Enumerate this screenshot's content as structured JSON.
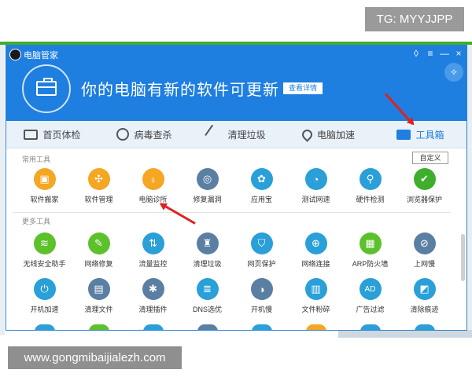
{
  "watermark": {
    "top": "TG: MYYJJPP",
    "bottom": "www.gongmibaijialezh.com"
  },
  "window": {
    "title": "电脑管家",
    "controls": [
      "◊",
      "≡",
      "—",
      "×"
    ],
    "headline": "你的电脑有新的软件可更新",
    "detail_button": "查看详情",
    "pin": "✧"
  },
  "nav": {
    "tabs": [
      {
        "label": "首页体检",
        "icon": "monitor-icon"
      },
      {
        "label": "病毒查杀",
        "icon": "virus-icon"
      },
      {
        "label": "清理垃圾",
        "icon": "broom-icon"
      },
      {
        "label": "电脑加速",
        "icon": "rocket-icon"
      },
      {
        "label": "工具箱",
        "icon": "toolbox-icon",
        "active": true
      }
    ]
  },
  "common_tools": {
    "label": "常用工具",
    "customize": "自定义",
    "items": [
      {
        "label": "软件搬家",
        "icon": "truck-icon",
        "color": "#f5a623",
        "glyph": "▣"
      },
      {
        "label": "软件管理",
        "icon": "clover-icon",
        "color": "#f5a623",
        "glyph": "✣"
      },
      {
        "label": "电脑诊所",
        "icon": "stethoscope-icon",
        "color": "#f5a623",
        "glyph": "♁"
      },
      {
        "label": "修复漏洞",
        "icon": "globe-repair-icon",
        "color": "#5b7fa3",
        "glyph": "◎"
      },
      {
        "label": "应用宝",
        "icon": "app-store-icon",
        "color": "#2a9fd8",
        "glyph": "✿"
      },
      {
        "label": "测试网速",
        "icon": "speedometer-icon",
        "color": "#2a9fd8",
        "glyph": "◔"
      },
      {
        "label": "硬件检测",
        "icon": "chip-search-icon",
        "color": "#2a9fd8",
        "glyph": "⚲"
      },
      {
        "label": "浏览器保护",
        "icon": "browser-shield-icon",
        "color": "#3fae2c",
        "glyph": "✔"
      }
    ]
  },
  "more_tools": {
    "label": "更多工具",
    "items": [
      {
        "label": "无线安全助手",
        "icon": "wifi-icon",
        "color": "#5cc12a",
        "glyph": "≋"
      },
      {
        "label": "网络修复",
        "icon": "wrench-icon",
        "color": "#5cc12a",
        "glyph": "✎"
      },
      {
        "label": "流量监控",
        "icon": "traffic-arrows-icon",
        "color": "#2a9fd8",
        "glyph": "⇅"
      },
      {
        "label": "清理垃圾",
        "icon": "trash-icon",
        "color": "#5b7fa3",
        "glyph": "♜"
      },
      {
        "label": "网页保护",
        "icon": "shield-icon",
        "color": "#2a9fd8",
        "glyph": "⛉"
      },
      {
        "label": "网络连接",
        "icon": "network-globe-icon",
        "color": "#2a9fd8",
        "glyph": "⊕"
      },
      {
        "label": "ARP防火墙",
        "icon": "firewall-icon",
        "color": "#5cc12a",
        "glyph": "▦"
      },
      {
        "label": "上网慢",
        "icon": "slow-net-icon",
        "color": "#5b7fa3",
        "glyph": "⊘"
      },
      {
        "label": "开机加速",
        "icon": "power-icon",
        "color": "#2a9fd8",
        "glyph": "⏻"
      },
      {
        "label": "清理文件",
        "icon": "file-clean-icon",
        "color": "#5b7fa3",
        "glyph": "▤"
      },
      {
        "label": "清理插件",
        "icon": "plugin-icon",
        "color": "#5b7fa3",
        "glyph": "✱"
      },
      {
        "label": "DNS选优",
        "icon": "dns-icon",
        "color": "#2a9fd8",
        "glyph": "≣"
      },
      {
        "label": "开机慢",
        "icon": "boot-slow-icon",
        "color": "#5b7fa3",
        "glyph": "◑"
      },
      {
        "label": "文件粉碎",
        "icon": "shredder-icon",
        "color": "#2a9fd8",
        "glyph": "▥"
      },
      {
        "label": "广告过滤",
        "icon": "ad-filter-icon",
        "color": "#2a9fd8",
        "glyph": "AD"
      },
      {
        "label": "清除痕迹",
        "icon": "eraser-icon",
        "color": "#2a9fd8",
        "glyph": "◩"
      }
    ]
  },
  "partial_row_colors": [
    "#2a9fd8",
    "#5cc12a",
    "#2a9fd8",
    "#5b7fa3",
    "#2a9fd8",
    "#f5a623",
    "#2a9fd8",
    "#2a9fd8"
  ]
}
